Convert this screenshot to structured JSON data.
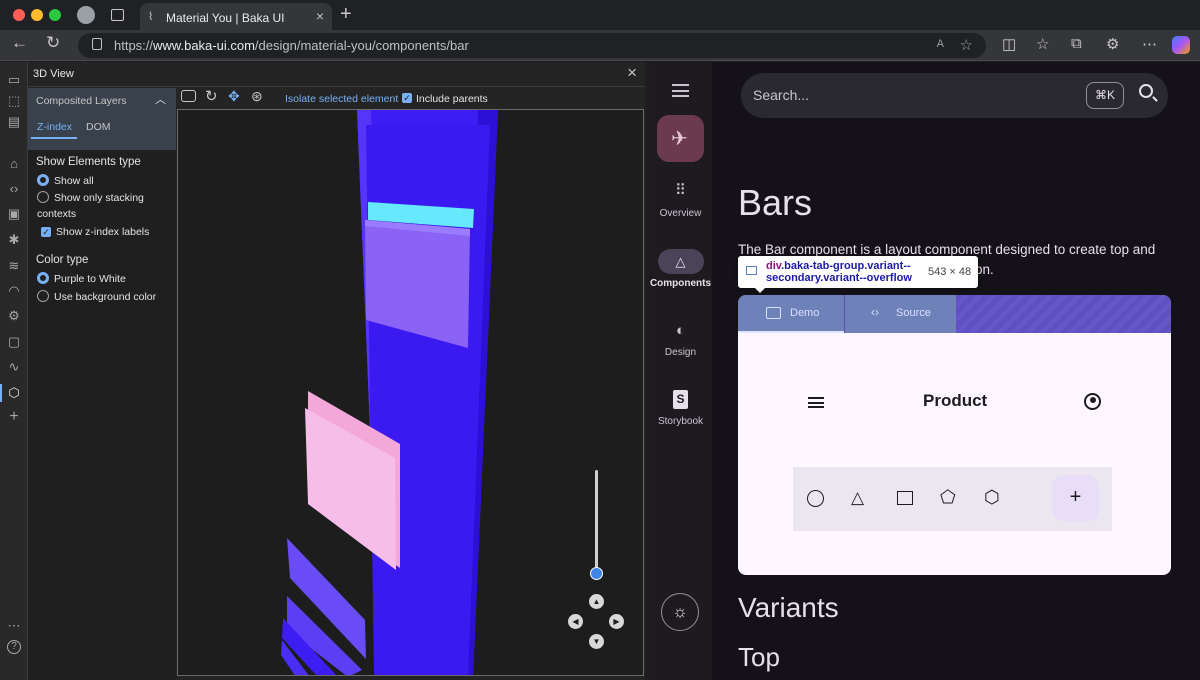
{
  "browser": {
    "tab_title": "Material You | Baka UI",
    "url_prefix": "https://",
    "url_host": "www.baka-ui.com",
    "url_path": "/design/material-you/components/bar"
  },
  "devtools": {
    "title": "3D View",
    "panel_title": "Composited Layers",
    "tabs": [
      "Z-index",
      "DOM"
    ],
    "show_elements_heading": "Show Elements type",
    "show_options": [
      {
        "label": "Show all",
        "selected": true
      },
      {
        "label": "Show only stacking",
        "selected": false
      }
    ],
    "show_options_cont": "contexts",
    "show_zindex_labels": "Show z-index labels",
    "color_type_heading": "Color type",
    "color_options": [
      {
        "label": "Purple to White",
        "selected": true
      },
      {
        "label": "Use background color",
        "selected": false
      }
    ],
    "isolate_label": "Isolate selected element",
    "include_parents_label": "Include parents"
  },
  "app": {
    "search_placeholder": "Search...",
    "search_shortcut": "⌘K",
    "rail": [
      {
        "label": "Overview",
        "icon": "grid-icon"
      },
      {
        "label": "Components",
        "icon": "shapes-icon"
      },
      {
        "label": "Design",
        "icon": "palette-icon"
      },
      {
        "label": "Storybook",
        "icon": "storybook-icon"
      }
    ],
    "page_title": "Bars",
    "description_line1": "The Bar component is a layout component designed to create top and",
    "description_line2": "on.",
    "tooltip_selector_1": "div",
    "tooltip_selector_2": ".baka-tab-group.variant--",
    "tooltip_selector_3": "secondary.variant--overflow",
    "tooltip_size": "543 × 48",
    "demo_tabs": [
      "Demo",
      "Source"
    ],
    "demo_bar_title": "Product",
    "section_variants": "Variants",
    "section_top": "Top"
  },
  "colors": {
    "accent": "#77b0f5",
    "layer_blue": "#3e1df5",
    "layer_cyan": "#66e8ff",
    "layer_pink": "#f5bde8",
    "surface": "#fef7ff"
  }
}
